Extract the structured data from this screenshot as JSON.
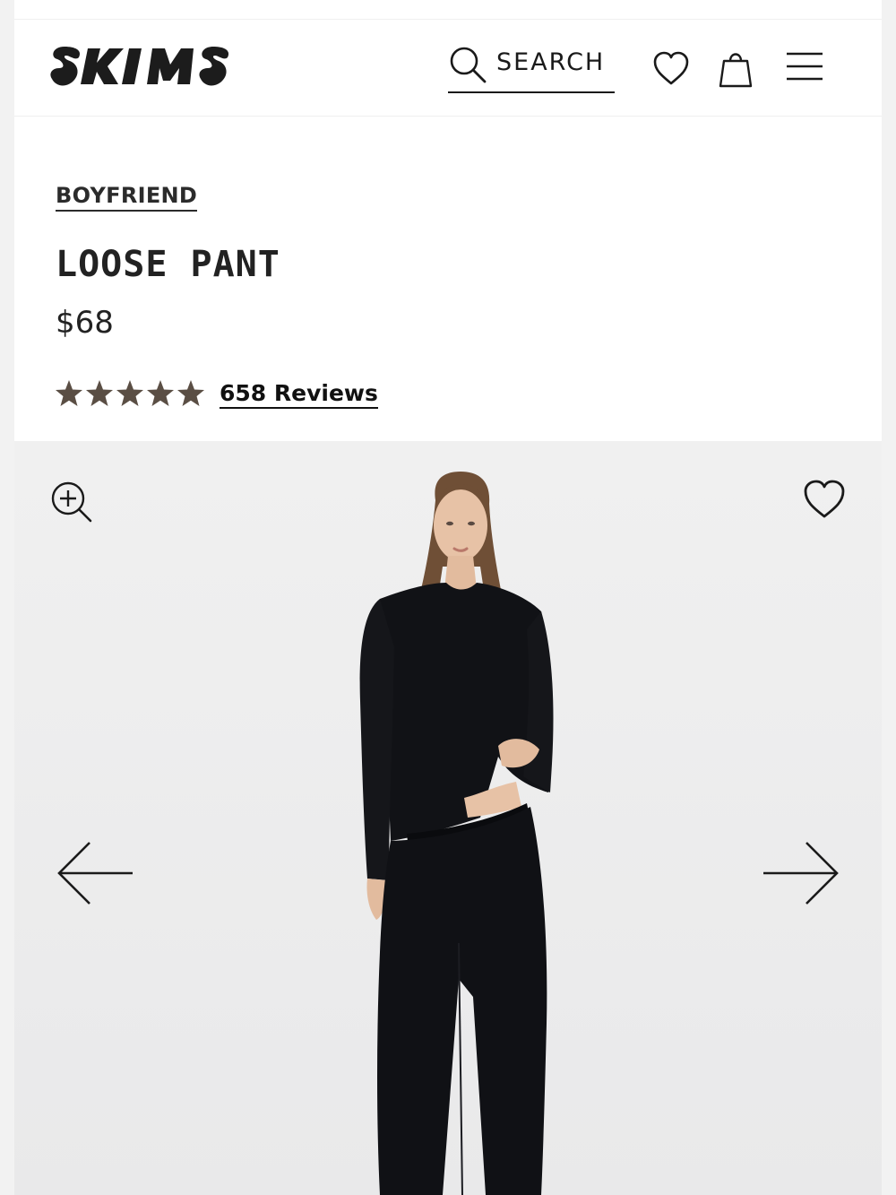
{
  "header": {
    "logo_text": "SKIMS",
    "search_label": "SEARCH",
    "icons": [
      "search-icon",
      "heart-icon",
      "shopping-bag-icon",
      "hamburger-menu-icon"
    ]
  },
  "product": {
    "collection": "BOYFRIEND",
    "title": "LOOSE PANT",
    "price": "$68",
    "rating": 5,
    "rating_max": 5,
    "reviews_label": "658 Reviews"
  },
  "gallery": {
    "icons": [
      "zoom-in-icon",
      "heart-icon",
      "arrow-left-icon",
      "arrow-right-icon"
    ]
  },
  "colors": {
    "text": "#1a1a1a",
    "star": "#5a4e44",
    "gallery_bg": "#efefef",
    "garment": "#111216"
  }
}
